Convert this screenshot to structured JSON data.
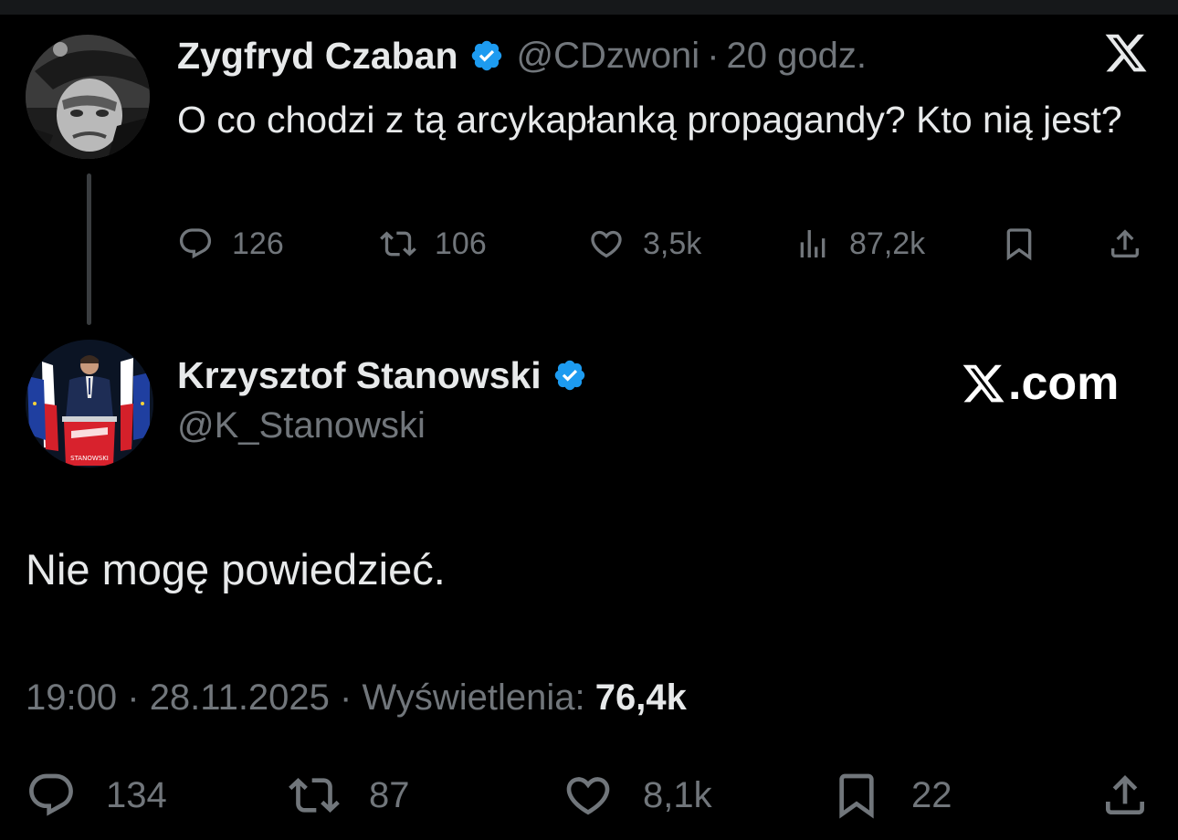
{
  "parent_tweet": {
    "author_name": "Zygfryd Czaban",
    "handle": "@CDzwoni",
    "separator": "·",
    "time": "20 godz.",
    "text": "O co chodzi z tą arcykapłanką propagandy? Kto nią jest?",
    "replies": "126",
    "reposts": "106",
    "likes": "3,5k",
    "views": "87,2k"
  },
  "main_tweet": {
    "author_name": "Krzysztof Stanowski",
    "handle": "@K_Stanowski",
    "brand": ".com",
    "text": "Nie mogę powiedzieć.",
    "time": "19:00",
    "separator": "·",
    "date": "28.11.2025",
    "views_label": "Wyświetlenia:",
    "views": "76,4k",
    "replies": "134",
    "reposts": "87",
    "likes": "8,1k",
    "bookmarks": "22",
    "podium_text": "STANOWSKI"
  },
  "colors": {
    "background": "#000000",
    "text_primary": "#e7e9ea",
    "text_secondary": "#71767b",
    "verified_blue": "#1d9bf0"
  },
  "icons": [
    "reply-icon",
    "repost-icon",
    "like-icon",
    "views-icon",
    "bookmark-icon",
    "share-icon",
    "x-logo-icon",
    "verified-badge-icon"
  ]
}
